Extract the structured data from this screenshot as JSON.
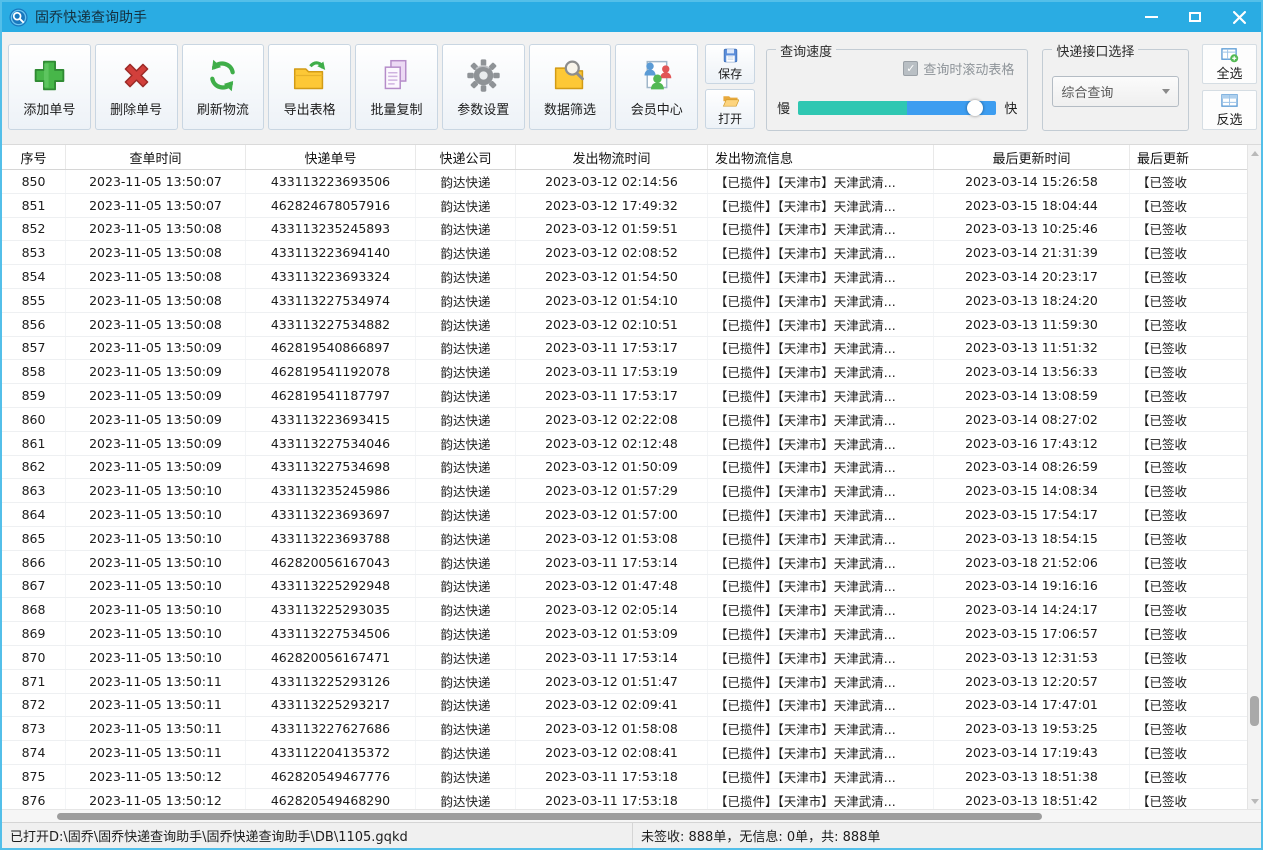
{
  "window": {
    "title": "固乔快递查询助手"
  },
  "icons": {
    "app-icon": "blue-magnifier-badge",
    "add-icon": "green-plus",
    "delete-icon": "red-x",
    "refresh-icon": "green-circular-arrows",
    "export-icon": "yellow-folder-green-arrow",
    "copy-icon": "purple-duplicate-pages",
    "settings-icon": "gray-gear",
    "filter-icon": "yellow-folder-magnifier",
    "member-icon": "three-people-document",
    "save-icon": "blue-floppy",
    "open-icon": "orange-folder",
    "select-all-icon": "grid-with-green-plus",
    "invert-select-icon": "grid-highlighted-row",
    "minimize-icon": "white-bar",
    "maximize-icon": "white-square",
    "close-icon": "white-x"
  },
  "toolbar": {
    "buttons": [
      {
        "label": "添加单号"
      },
      {
        "label": "删除单号"
      },
      {
        "label": "刷新物流"
      },
      {
        "label": "导出表格"
      },
      {
        "label": "批量复制"
      },
      {
        "label": "参数设置"
      },
      {
        "label": "数据筛选"
      },
      {
        "label": "会员中心"
      }
    ],
    "save_label": "保存",
    "open_label": "打开"
  },
  "speed_panel": {
    "title": "查询速度",
    "checkbox_label": "查询时滚动表格",
    "checkbox_checked": true,
    "slow_label": "慢",
    "fast_label": "快",
    "fill_percent": 55,
    "thumb_percent": 89,
    "fill_color": "#2fc7b2",
    "rest_color": "#3d9df0"
  },
  "interface_panel": {
    "title": "快递接口选择",
    "selected_option": "综合查询"
  },
  "selection": {
    "select_all_label": "全选",
    "invert_label": "反选"
  },
  "table": {
    "columns": [
      "序号",
      "查单时间",
      "快递单号",
      "快递公司",
      "发出物流时间",
      "发出物流信息",
      "最后更新时间",
      "最后更新"
    ],
    "rows": [
      [
        "850",
        "2023-11-05 13:50:07",
        "433113223693506",
        "韵达快递",
        "2023-03-12 02:14:56",
        "【已揽件】【天津市】天津武清...",
        "2023-03-14 15:26:58",
        "【已签收"
      ],
      [
        "851",
        "2023-11-05 13:50:07",
        "462824678057916",
        "韵达快递",
        "2023-03-12 17:49:32",
        "【已揽件】【天津市】天津武清...",
        "2023-03-15 18:04:44",
        "【已签收"
      ],
      [
        "852",
        "2023-11-05 13:50:08",
        "433113235245893",
        "韵达快递",
        "2023-03-12 01:59:51",
        "【已揽件】【天津市】天津武清...",
        "2023-03-13 10:25:46",
        "【已签收"
      ],
      [
        "853",
        "2023-11-05 13:50:08",
        "433113223694140",
        "韵达快递",
        "2023-03-12 02:08:52",
        "【已揽件】【天津市】天津武清...",
        "2023-03-14 21:31:39",
        "【已签收"
      ],
      [
        "854",
        "2023-11-05 13:50:08",
        "433113223693324",
        "韵达快递",
        "2023-03-12 01:54:50",
        "【已揽件】【天津市】天津武清...",
        "2023-03-14 20:23:17",
        "【已签收"
      ],
      [
        "855",
        "2023-11-05 13:50:08",
        "433113227534974",
        "韵达快递",
        "2023-03-12 01:54:10",
        "【已揽件】【天津市】天津武清...",
        "2023-03-13 18:24:20",
        "【已签收"
      ],
      [
        "856",
        "2023-11-05 13:50:08",
        "433113227534882",
        "韵达快递",
        "2023-03-12 02:10:51",
        "【已揽件】【天津市】天津武清...",
        "2023-03-13 11:59:30",
        "【已签收"
      ],
      [
        "857",
        "2023-11-05 13:50:09",
        "462819540866897",
        "韵达快递",
        "2023-03-11 17:53:17",
        "【已揽件】【天津市】天津武清...",
        "2023-03-13 11:51:32",
        "【已签收"
      ],
      [
        "858",
        "2023-11-05 13:50:09",
        "462819541192078",
        "韵达快递",
        "2023-03-11 17:53:19",
        "【已揽件】【天津市】天津武清...",
        "2023-03-14 13:56:33",
        "【已签收"
      ],
      [
        "859",
        "2023-11-05 13:50:09",
        "462819541187797",
        "韵达快递",
        "2023-03-11 17:53:17",
        "【已揽件】【天津市】天津武清...",
        "2023-03-14 13:08:59",
        "【已签收"
      ],
      [
        "860",
        "2023-11-05 13:50:09",
        "433113223693415",
        "韵达快递",
        "2023-03-12 02:22:08",
        "【已揽件】【天津市】天津武清...",
        "2023-03-14 08:27:02",
        "【已签收"
      ],
      [
        "861",
        "2023-11-05 13:50:09",
        "433113227534046",
        "韵达快递",
        "2023-03-12 02:12:48",
        "【已揽件】【天津市】天津武清...",
        "2023-03-16 17:43:12",
        "【已签收"
      ],
      [
        "862",
        "2023-11-05 13:50:09",
        "433113227534698",
        "韵达快递",
        "2023-03-12 01:50:09",
        "【已揽件】【天津市】天津武清...",
        "2023-03-14 08:26:59",
        "【已签收"
      ],
      [
        "863",
        "2023-11-05 13:50:10",
        "433113235245986",
        "韵达快递",
        "2023-03-12 01:57:29",
        "【已揽件】【天津市】天津武清...",
        "2023-03-15 14:08:34",
        "【已签收"
      ],
      [
        "864",
        "2023-11-05 13:50:10",
        "433113223693697",
        "韵达快递",
        "2023-03-12 01:57:00",
        "【已揽件】【天津市】天津武清...",
        "2023-03-15 17:54:17",
        "【已签收"
      ],
      [
        "865",
        "2023-11-05 13:50:10",
        "433113223693788",
        "韵达快递",
        "2023-03-12 01:53:08",
        "【已揽件】【天津市】天津武清...",
        "2023-03-13 18:54:15",
        "【已签收"
      ],
      [
        "866",
        "2023-11-05 13:50:10",
        "462820056167043",
        "韵达快递",
        "2023-03-11 17:53:14",
        "【已揽件】【天津市】天津武清...",
        "2023-03-18 21:52:06",
        "【已签收"
      ],
      [
        "867",
        "2023-11-05 13:50:10",
        "433113225292948",
        "韵达快递",
        "2023-03-12 01:47:48",
        "【已揽件】【天津市】天津武清...",
        "2023-03-14 19:16:16",
        "【已签收"
      ],
      [
        "868",
        "2023-11-05 13:50:10",
        "433113225293035",
        "韵达快递",
        "2023-03-12 02:05:14",
        "【已揽件】【天津市】天津武清...",
        "2023-03-14 14:24:17",
        "【已签收"
      ],
      [
        "869",
        "2023-11-05 13:50:10",
        "433113227534506",
        "韵达快递",
        "2023-03-12 01:53:09",
        "【已揽件】【天津市】天津武清...",
        "2023-03-15 17:06:57",
        "【已签收"
      ],
      [
        "870",
        "2023-11-05 13:50:10",
        "462820056167471",
        "韵达快递",
        "2023-03-11 17:53:14",
        "【已揽件】【天津市】天津武清...",
        "2023-03-13 12:31:53",
        "【已签收"
      ],
      [
        "871",
        "2023-11-05 13:50:11",
        "433113225293126",
        "韵达快递",
        "2023-03-12 01:51:47",
        "【已揽件】【天津市】天津武清...",
        "2023-03-13 12:20:57",
        "【已签收"
      ],
      [
        "872",
        "2023-11-05 13:50:11",
        "433113225293217",
        "韵达快递",
        "2023-03-12 02:09:41",
        "【已揽件】【天津市】天津武清...",
        "2023-03-14 17:47:01",
        "【已签收"
      ],
      [
        "873",
        "2023-11-05 13:50:11",
        "433113227627686",
        "韵达快递",
        "2023-03-12 01:58:08",
        "【已揽件】【天津市】天津武清...",
        "2023-03-13 19:53:25",
        "【已签收"
      ],
      [
        "874",
        "2023-11-05 13:50:11",
        "433112204135372",
        "韵达快递",
        "2023-03-12 02:08:41",
        "【已揽件】【天津市】天津武清...",
        "2023-03-14 17:19:43",
        "【已签收"
      ],
      [
        "875",
        "2023-11-05 13:50:12",
        "462820549467776",
        "韵达快递",
        "2023-03-11 17:53:18",
        "【已揽件】【天津市】天津武清...",
        "2023-03-13 18:51:38",
        "【已签收"
      ],
      [
        "876",
        "2023-11-05 13:50:12",
        "462820549468290",
        "韵达快递",
        "2023-03-11 17:53:18",
        "【已揽件】【天津市】天津武清...",
        "2023-03-13 18:51:42",
        "【已签收"
      ]
    ],
    "column_align": [
      "center",
      "center",
      "center",
      "center",
      "center",
      "left",
      "center",
      "left"
    ]
  },
  "statusbar": {
    "left": "已打开D:\\固乔\\固乔快递查询助手\\固乔快递查询助手\\DB\\1105.gqkd",
    "right": "未签收: 888单，无信息: 0单，共: 888单"
  }
}
